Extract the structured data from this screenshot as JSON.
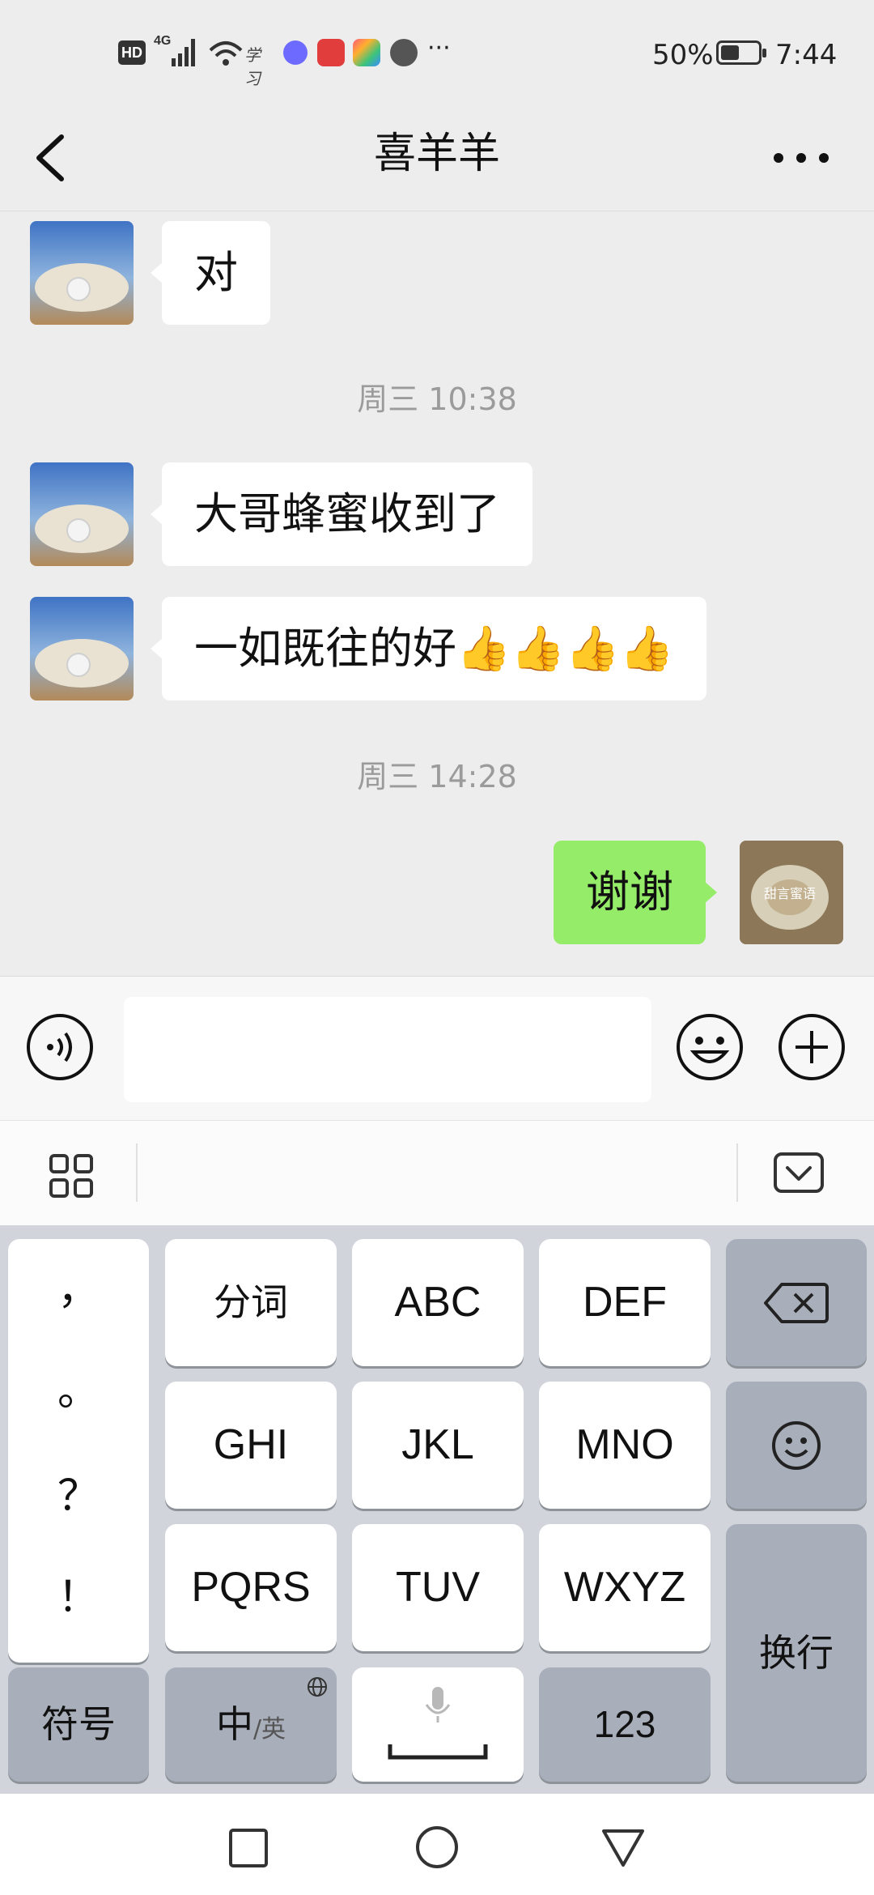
{
  "status_bar": {
    "network_hd": "HD",
    "network_gen": "4G",
    "battery_percent": "50%",
    "time": "7:44",
    "more_indicator": "···",
    "icons": [
      "hd-icon",
      "signal-icon",
      "wifi-icon",
      "xuexi-icon",
      "music-app-icon",
      "book-app-icon",
      "palette-app-icon",
      "browser-app-icon"
    ]
  },
  "header": {
    "title": "喜羊羊",
    "back_icon": "chevron-left-icon",
    "more_icon": "more-dots-icon"
  },
  "messages": [
    {
      "side": "left",
      "text": "对"
    },
    {
      "side": "left",
      "text": "大哥蜂蜜收到了"
    },
    {
      "side": "left",
      "text": "一如既往的好👍👍👍👍"
    },
    {
      "side": "right",
      "text": "谢谢"
    }
  ],
  "timestamps": [
    "周三 10:38",
    "周三 14:28"
  ],
  "my_avatar_caption": "甜言蜜语",
  "input_bar": {
    "value": "",
    "voice_icon": "voice-icon",
    "emoji_icon": "emoji-icon",
    "plus_icon": "plus-icon"
  },
  "keyboard_toolbar": {
    "grid_icon": "grid-icon",
    "collapse_icon": "keyboard-collapse-icon"
  },
  "keyboard": {
    "punctuation": [
      "，",
      "。",
      "？",
      "！"
    ],
    "keys": [
      "分词",
      "ABC",
      "DEF",
      "GHI",
      "JKL",
      "MNO",
      "PQRS",
      "TUV",
      "WXYZ"
    ],
    "backspace_icon": "backspace-icon",
    "emoji_key_icon": "smiley-icon",
    "enter": "换行",
    "symbols": "符号",
    "lang_main": "中",
    "lang_alt": "/英",
    "numbers": "123",
    "accent": "#95ec69"
  },
  "nav_bar": {
    "icons": [
      "recent-apps-icon",
      "home-icon",
      "back-triangle-icon"
    ]
  }
}
